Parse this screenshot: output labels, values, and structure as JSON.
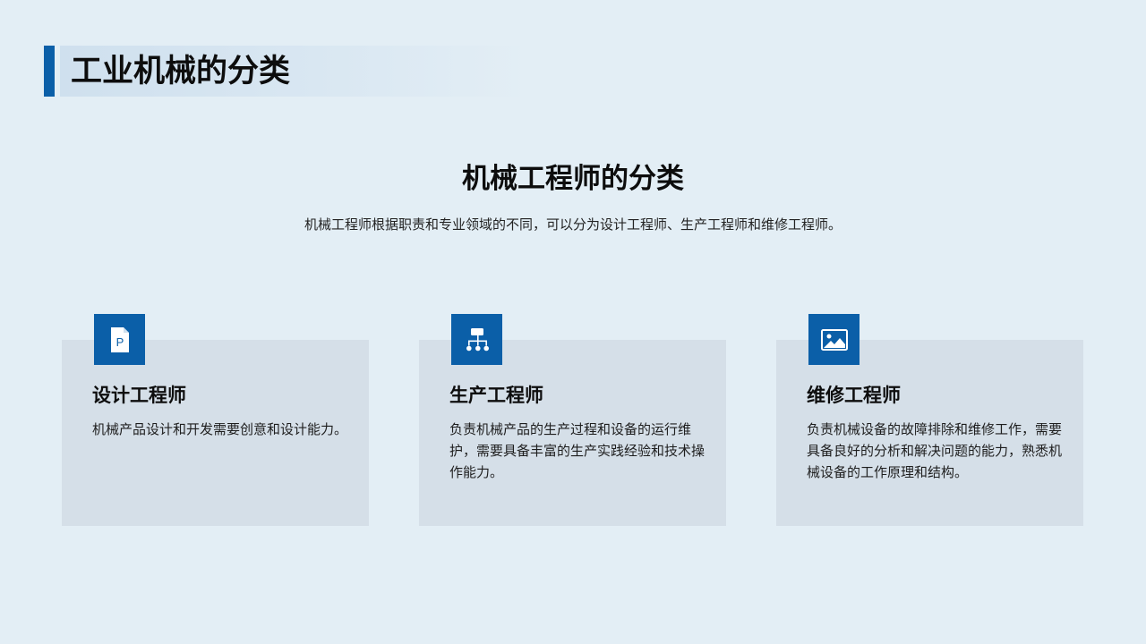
{
  "header": {
    "title": "工业机械的分类"
  },
  "section": {
    "title": "机械工程师的分类",
    "subtitle": "机械工程师根据职责和专业领域的不同，可以分为设计工程师、生产工程师和维修工程师。"
  },
  "cards": [
    {
      "icon": "document-p-icon",
      "title": "设计工程师",
      "description": "机械产品设计和开发需要创意和设计能力。"
    },
    {
      "icon": "org-chart-icon",
      "title": "生产工程师",
      "description": "负责机械产品的生产过程和设备的运行维护，需要具备丰富的生产实践经验和技术操作能力。"
    },
    {
      "icon": "image-icon",
      "title": "维修工程师",
      "description": "负责机械设备的故障排除和维修工作，需要具备良好的分析和解决问题的能力，熟悉机械设备的工作原理和结构。"
    }
  ],
  "colors": {
    "background": "#e3eef5",
    "accent": "#0b5fa8",
    "card": "#d5dfe8"
  }
}
